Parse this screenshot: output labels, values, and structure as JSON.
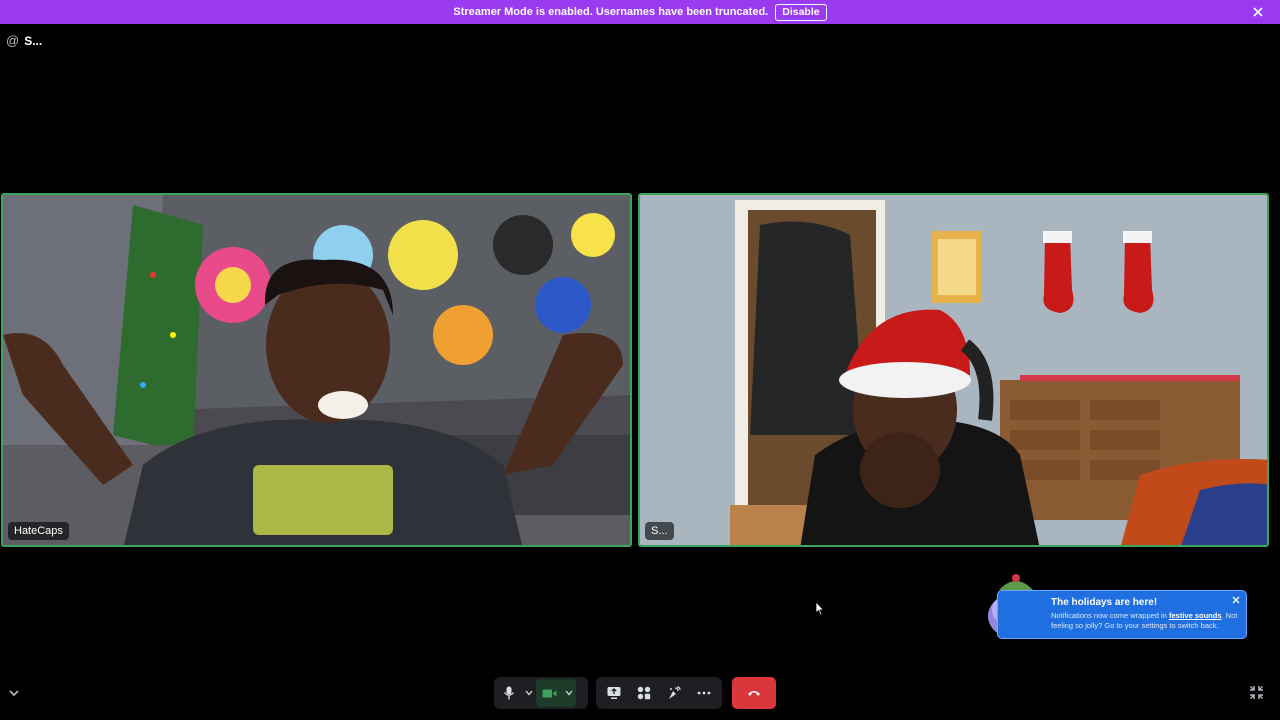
{
  "banner": {
    "text": "Streamer Mode is enabled. Usernames have been truncated.",
    "button_label": "Disable",
    "bg_color": "#9b3bf0"
  },
  "channel": {
    "prefix": "@",
    "name": "S..."
  },
  "participants": [
    {
      "name": "HateCaps",
      "speaking": true
    },
    {
      "name": "S...",
      "speaking": true
    }
  ],
  "popup": {
    "title": "The holidays are here!",
    "body_pre": "Notifications now come wrapped in ",
    "body_link": "festive sounds",
    "body_post": ". Not feeling so jolly? Go to your settings to switch back."
  },
  "controls": {
    "icons": [
      "microphone-icon",
      "camera-icon",
      "screen-share-icon",
      "activities-icon",
      "soundboard-icon",
      "more-icon",
      "hang-up-icon"
    ],
    "hangup_color": "#da373c",
    "speaking_color": "#3ba55c"
  }
}
